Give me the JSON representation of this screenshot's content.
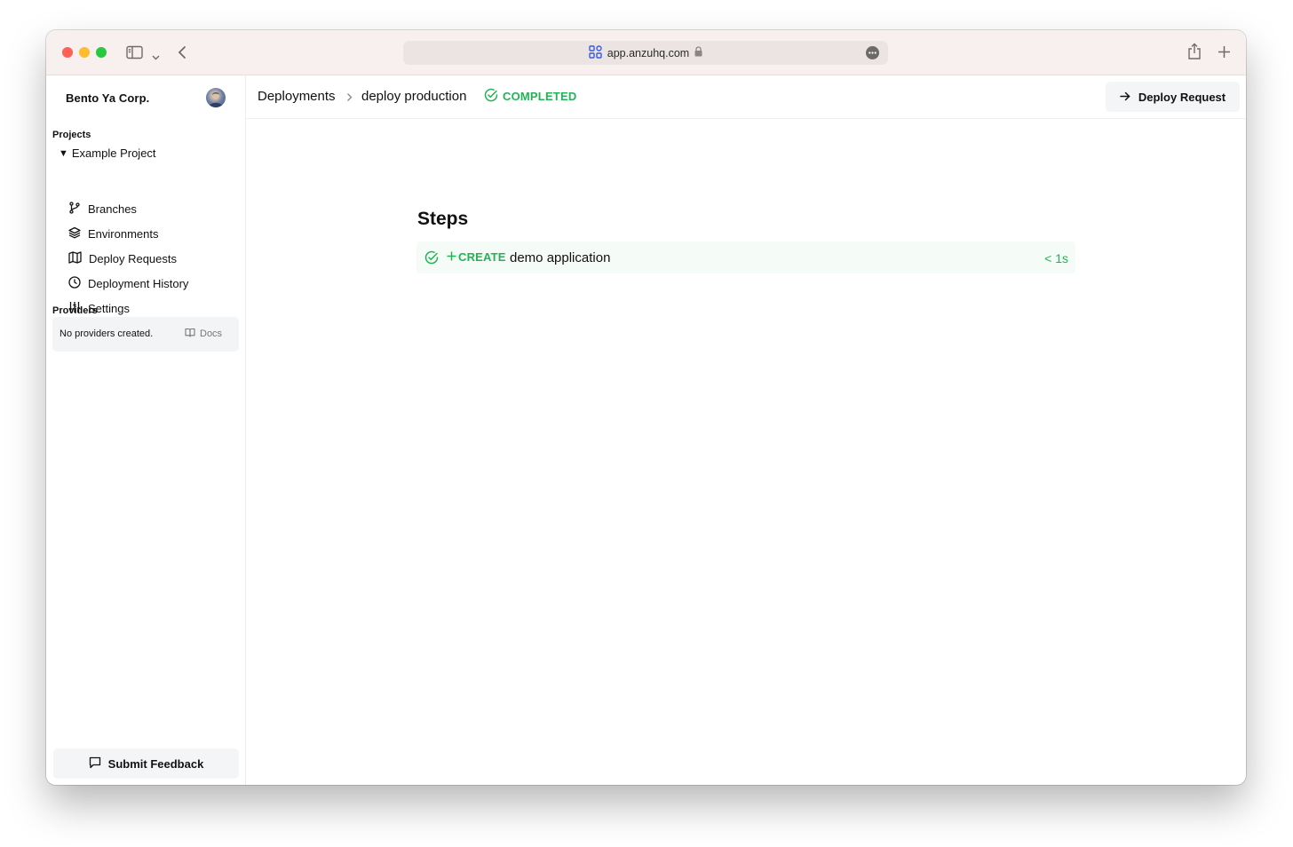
{
  "browser": {
    "url": "app.anzuhq.com"
  },
  "sidebar": {
    "org_name": "Bento Ya Corp.",
    "projects_title": "Projects",
    "project_name": "Example Project",
    "project_toggle": "▼",
    "nav_items": [
      {
        "label": "Branches",
        "icon": "branch-icon"
      },
      {
        "label": "Environments",
        "icon": "layers-icon"
      },
      {
        "label": "Deploy Requests",
        "icon": "map-icon"
      },
      {
        "label": "Deployment History",
        "icon": "clock-icon"
      },
      {
        "label": "Settings",
        "icon": "sliders-icon"
      }
    ],
    "providers_title": "Providers",
    "providers_empty": "No providers created.",
    "docs_label": "Docs",
    "feedback_label": "Submit Feedback"
  },
  "header": {
    "breadcrumb_root": "Deployments",
    "breadcrumb_current": "deploy production",
    "status": "COMPLETED",
    "deploy_request_label": "Deploy Request"
  },
  "main": {
    "steps_title": "Steps",
    "steps": [
      {
        "action": "CREATE",
        "name": "demo application",
        "duration": "< 1s"
      }
    ]
  },
  "colors": {
    "success": "#22b356",
    "titlebar": "#f7f0ee"
  }
}
